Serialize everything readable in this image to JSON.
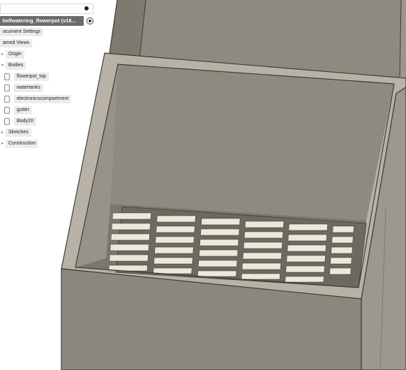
{
  "browser": {
    "root": "Selfwatering_flowerpot (v18...",
    "items": [
      {
        "label": "ocument Settings"
      },
      {
        "label": "amed Views"
      },
      {
        "label": "Origin"
      },
      {
        "label": "Bodies"
      },
      {
        "label": "flowerpot_top"
      },
      {
        "label": "watertanks"
      },
      {
        "label": "electronicscompartment"
      },
      {
        "label": "gutter"
      },
      {
        "label": "Body20"
      },
      {
        "label": "Sketches"
      },
      {
        "label": "Construction"
      }
    ]
  },
  "icons": {
    "topbar": "record-dot-icon",
    "root": "radio-target-icon",
    "body": "body-icon",
    "expand": "expand-arrow-icon"
  },
  "colors": {
    "root_bg": "#6b6b6b",
    "node_bg": "#ececec",
    "model_face": "#8c877d",
    "model_rim": "#b8b2a6"
  }
}
